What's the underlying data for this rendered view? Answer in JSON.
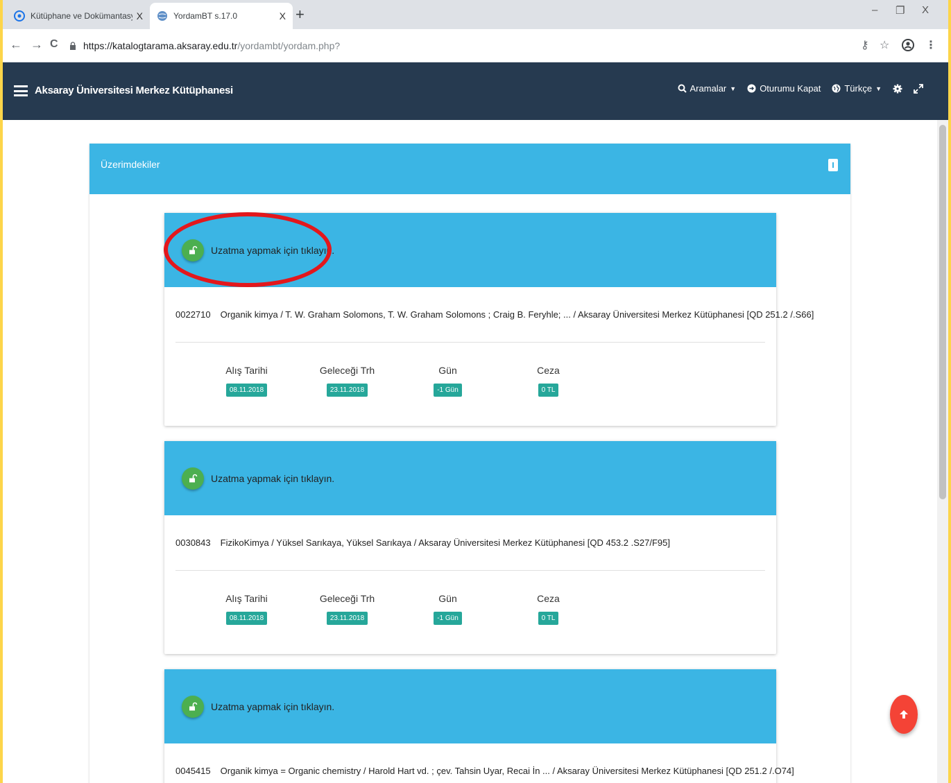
{
  "browser": {
    "tabs": [
      {
        "title": "Kütüphane ve Dokümantasyon D",
        "active": false,
        "close": "X"
      },
      {
        "title": "YordamBT s.17.0",
        "active": true,
        "close": "X"
      }
    ],
    "new_tab": "+",
    "window_controls": {
      "minimize": "–",
      "maximize": "❐",
      "close": "X"
    },
    "nav": {
      "back": "←",
      "forward": "→",
      "reload": "C"
    },
    "url_host": "https://katalogtarama.aksaray.edu.tr",
    "url_path": "/yordambt/yordam.php?",
    "toolbar_icons": {
      "key": "⚷",
      "star": "☆",
      "menu": "⋮"
    }
  },
  "header": {
    "brand": "Aksaray Üniversitesi Merkez Kütüphanesi",
    "menu": {
      "search": "Aramalar",
      "logout": "Oturumu Kapat",
      "language": "Türkçe"
    }
  },
  "panel": {
    "title": "Üzerimdekiler"
  },
  "loans": [
    {
      "renew_text": "Uzatma yapmak için tıklayın.",
      "code": "0022710",
      "description": "Organik kimya / T. W. Graham Solomons, T. W. Graham Solomons ; Craig B. Feryhle; ... / Aksaray Üniversitesi Merkez Kütüphanesi [QD 251.2 /.S66]",
      "stats": [
        {
          "label": "Alış Tarihi",
          "value": "08.11.2018"
        },
        {
          "label": "Geleceği Trh",
          "value": "23.11.2018"
        },
        {
          "label": "Gün",
          "value": "-1 Gün"
        },
        {
          "label": "Ceza",
          "value": "0 TL"
        }
      ]
    },
    {
      "renew_text": "Uzatma yapmak için tıklayın.",
      "code": "0030843",
      "description": "FizikoKimya / Yüksel Sarıkaya, Yüksel Sarıkaya / Aksaray Üniversitesi Merkez Kütüphanesi [QD 453.2 .S27/F95]",
      "stats": [
        {
          "label": "Alış Tarihi",
          "value": "08.11.2018"
        },
        {
          "label": "Geleceği Trh",
          "value": "23.11.2018"
        },
        {
          "label": "Gün",
          "value": "-1 Gün"
        },
        {
          "label": "Ceza",
          "value": "0 TL"
        }
      ]
    },
    {
      "renew_text": "Uzatma yapmak için tıklayın.",
      "code": "0045415",
      "description": "Organik kimya = Organic chemistry / Harold Hart vd. ; çev. Tahsin Uyar, Recai İn ... / Aksaray Üniversitesi Merkez Kütüphanesi [QD 251.2 /.O74]"
    }
  ],
  "colors": {
    "appbar": "#263a50",
    "accent": "#3bb5e4",
    "badge": "#26a79a",
    "renew_button": "#4caf50",
    "fab": "#f44336",
    "annotation": "#e3171c",
    "frame": "#fdd54a"
  }
}
